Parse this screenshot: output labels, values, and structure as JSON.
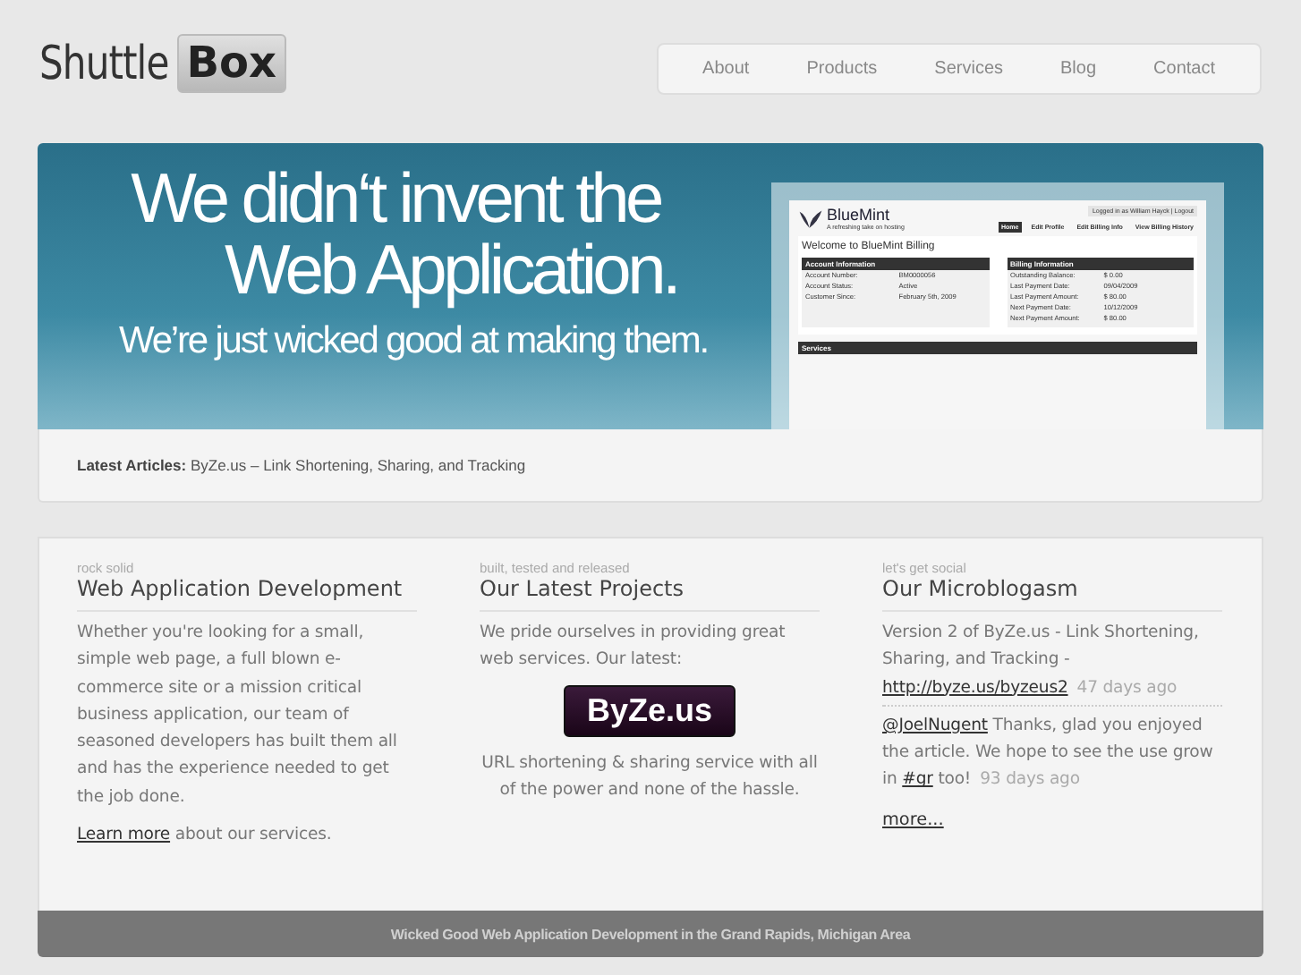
{
  "logo": {
    "text": "Shuttle",
    "badge": "Box"
  },
  "nav": [
    "About",
    "Products",
    "Services",
    "Blog",
    "Contact"
  ],
  "banner": {
    "headline": [
      "We didn‘t invent the",
      "Web Application."
    ],
    "tagline": "We’re just wicked good at making them.",
    "mockup": {
      "brand": "BlueMint",
      "slogan": "A refreshing take on hosting",
      "login": "Logged in as William Hayck | Logout",
      "nav": [
        {
          "label": "Home",
          "selected": true
        },
        {
          "label": "Edit Profile",
          "selected": false
        },
        {
          "label": "Edit Billing Info",
          "selected": false
        },
        {
          "label": "View Billing History",
          "selected": false
        }
      ],
      "welcome": "Welcome to BlueMint Billing",
      "panels": [
        {
          "title": "Account Information",
          "rows": [
            [
              "Account Number:",
              "BM0000056"
            ],
            [
              "Account Status:",
              "Active"
            ],
            [
              "Customer Since:",
              "February 5th, 2009"
            ]
          ]
        },
        {
          "title": "Billing Information",
          "rows": [
            [
              "Outstanding Balance:",
              "$ 0.00"
            ],
            [
              "Last Payment Date:",
              "09/04/2009"
            ],
            [
              "Last Payment Amount:",
              "$ 80.00"
            ],
            [
              "Next Payment Date:",
              "10/12/2009"
            ],
            [
              "Next Payment Amount:",
              "$ 80.00"
            ]
          ]
        }
      ],
      "services": "Services"
    }
  },
  "latest_articles": "**Latest Articles:** ByZe.us – Link Shortening, Sharing, and Tracking",
  "columns": [
    {
      "kind": "services",
      "kicker": "rock solid",
      "title": "Web Application Development",
      "body": "Whether you're looking for a small, simple web page, a full blown e-commerce site or a mission critical business application, our team of seasoned developers has built them all and has the experience needed to get the job done.",
      "link": "Learn more",
      "link_rest": " about our services."
    },
    {
      "kind": "projects",
      "kicker": "built, tested and released",
      "title": "Our Latest Projects",
      "body": "We pride ourselves in providing great web services. Our latest:",
      "badge": "ByZe.us",
      "caption": "URL shortening & sharing service with all of the power and none of the hassle."
    },
    {
      "kind": "social",
      "kicker": "let's get social",
      "title": "Our Microblogasm",
      "posts": [
        {
          "parts": [
            {
              "kind": "text",
              "text": "Version 2 of ByZe.us - Link Shortening, Sharing, and Tracking - "
            },
            {
              "kind": "link",
              "text": "http://byze.us/byzeus2"
            }
          ],
          "time": "47 days ago"
        },
        {
          "parts": [
            {
              "kind": "link",
              "text": "@JoelNugent"
            },
            {
              "kind": "text",
              "text": " Thanks, glad you enjoyed the article. We hope to see the use grow in "
            },
            {
              "kind": "link",
              "text": "#gr"
            },
            {
              "kind": "text",
              "text": " too!"
            }
          ],
          "time": "93 days ago"
        }
      ],
      "more": "more..."
    }
  ],
  "footer": "Wicked Good Web Application Development in the Grand Rapids, Michigan Area"
}
